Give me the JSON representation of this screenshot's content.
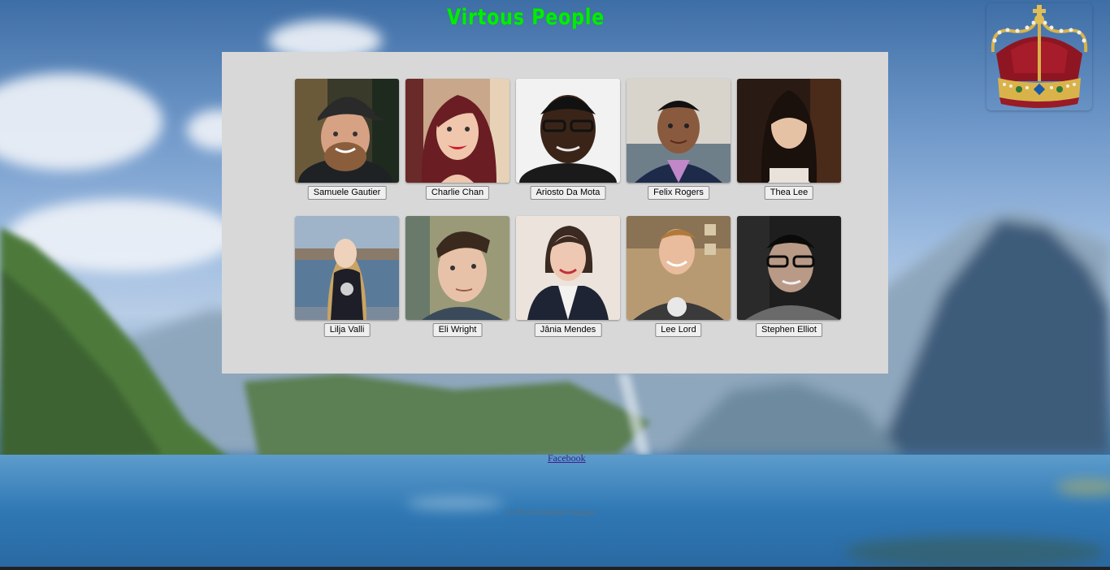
{
  "header": {
    "title": "Virtous People",
    "logo_icon": "crown-icon"
  },
  "colors": {
    "title": "#00ee00",
    "panel_background": "#d8d8d8",
    "button_background": "#efefef"
  },
  "people": [
    {
      "name": "Samuele Gautier"
    },
    {
      "name": "Charlie Chan"
    },
    {
      "name": "Ariosto Da Mota"
    },
    {
      "name": "Felix Rogers"
    },
    {
      "name": "Thea Lee"
    },
    {
      "name": "Lilja Valli"
    },
    {
      "name": "Eli Wright"
    },
    {
      "name": "Jânia Mendes"
    },
    {
      "name": "Lee Lord"
    },
    {
      "name": "Stephen Elliot"
    }
  ],
  "footer": {
    "link_label": "Facebook",
    "copyright": "© 2018 Jeremiah Asuquo"
  }
}
